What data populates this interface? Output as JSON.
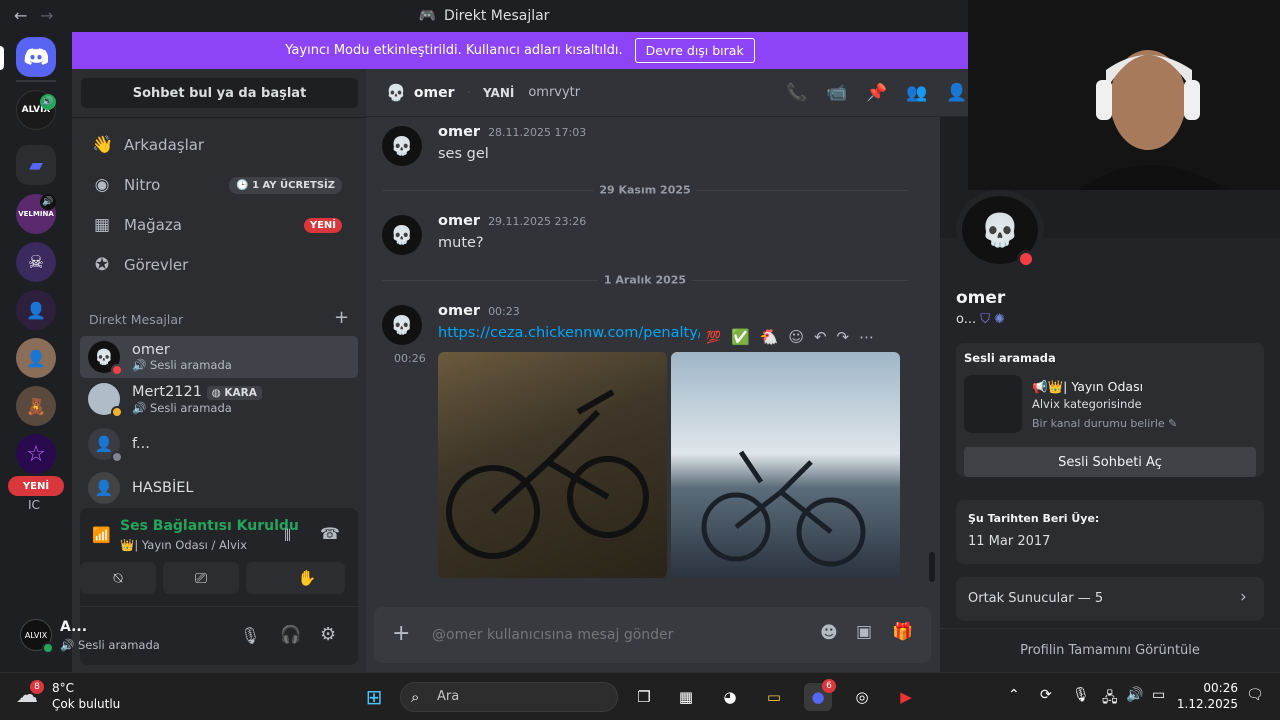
{
  "titlebar": {
    "title": "Direkt Mesajlar",
    "back": "←",
    "forward": "→"
  },
  "banner": {
    "text": "Yayıncı Modu etkinleştirildi. Kullanıcı adları kısaltıldı.",
    "button": "Devre dışı bırak"
  },
  "rail": {
    "new_badge": "YENİ",
    "alvix": "ALVIX",
    "velmina": "VELMINA",
    "partial": "IC"
  },
  "sidebar": {
    "search": "Sohbet bul ya da başlat",
    "nav": [
      {
        "label": "Arkadaşlar",
        "icon": "friends-icon"
      },
      {
        "label": "Nitro",
        "icon": "nitro-icon",
        "badge": "1 AY ÜCRETSİZ"
      },
      {
        "label": "Mağaza",
        "icon": "shop-icon",
        "badge": "YENİ"
      },
      {
        "label": "Görevler",
        "icon": "quests-icon"
      }
    ],
    "dm_header": "Direkt Mesajlar",
    "dm_add": "+",
    "dms": [
      {
        "name": "omer",
        "sub": "Sesli aramada"
      },
      {
        "name": "Mert2121",
        "tag": "KARA",
        "sub": "Sesli aramada"
      },
      {
        "name": "f...",
        "sub": ""
      },
      {
        "name": "HASBİEL",
        "sub": ""
      }
    ]
  },
  "voice": {
    "status": "Ses Bağlantısı Kuruldu",
    "channel": "👑| Yayın Odası / Alvix"
  },
  "user": {
    "name": "A...",
    "status": "Sesli aramada"
  },
  "chat": {
    "header": {
      "name": "omer",
      "tag": "YANİ",
      "username": "omrvytr"
    },
    "messages": [
      {
        "author": "omer",
        "time": "28.11.2025 17:03",
        "text": "ses gel"
      },
      {
        "author": "omer",
        "time": "29.11.2025 23:26",
        "text": "mute?"
      },
      {
        "author": "omer",
        "time": "00:23",
        "text": "https://ceza.chickennw.com/penalty/b"
      }
    ],
    "dividers": [
      "29 Kasım 2025",
      "1 Aralık 2025"
    ],
    "image_time": "00:26",
    "composer_placeholder": "@omer kullanıcısına mesaj gönder"
  },
  "profile": {
    "name": "omer",
    "short": "o...",
    "voice_title": "Sesli aramada",
    "voice_channel": "📢👑| Yayın Odası",
    "voice_category": "Alvix kategorisinde",
    "voice_status_hint": "Bir kanal durumu belirle ✎",
    "open_voice": "Sesli Sohbeti Aç",
    "member_since_label": "Şu Tarihten Beri Üye:",
    "member_since": "11 Mar 2017",
    "mutual": "Ortak Sunucular — 5",
    "view_full": "Profilin Tamamını Görüntüle"
  },
  "taskbar": {
    "weather_temp": "8°C",
    "weather_desc": "Çok bulutlu",
    "weather_badge": "8",
    "search": "Ara",
    "time": "00:26",
    "date": "1.12.2025",
    "discord_badge": "6"
  }
}
